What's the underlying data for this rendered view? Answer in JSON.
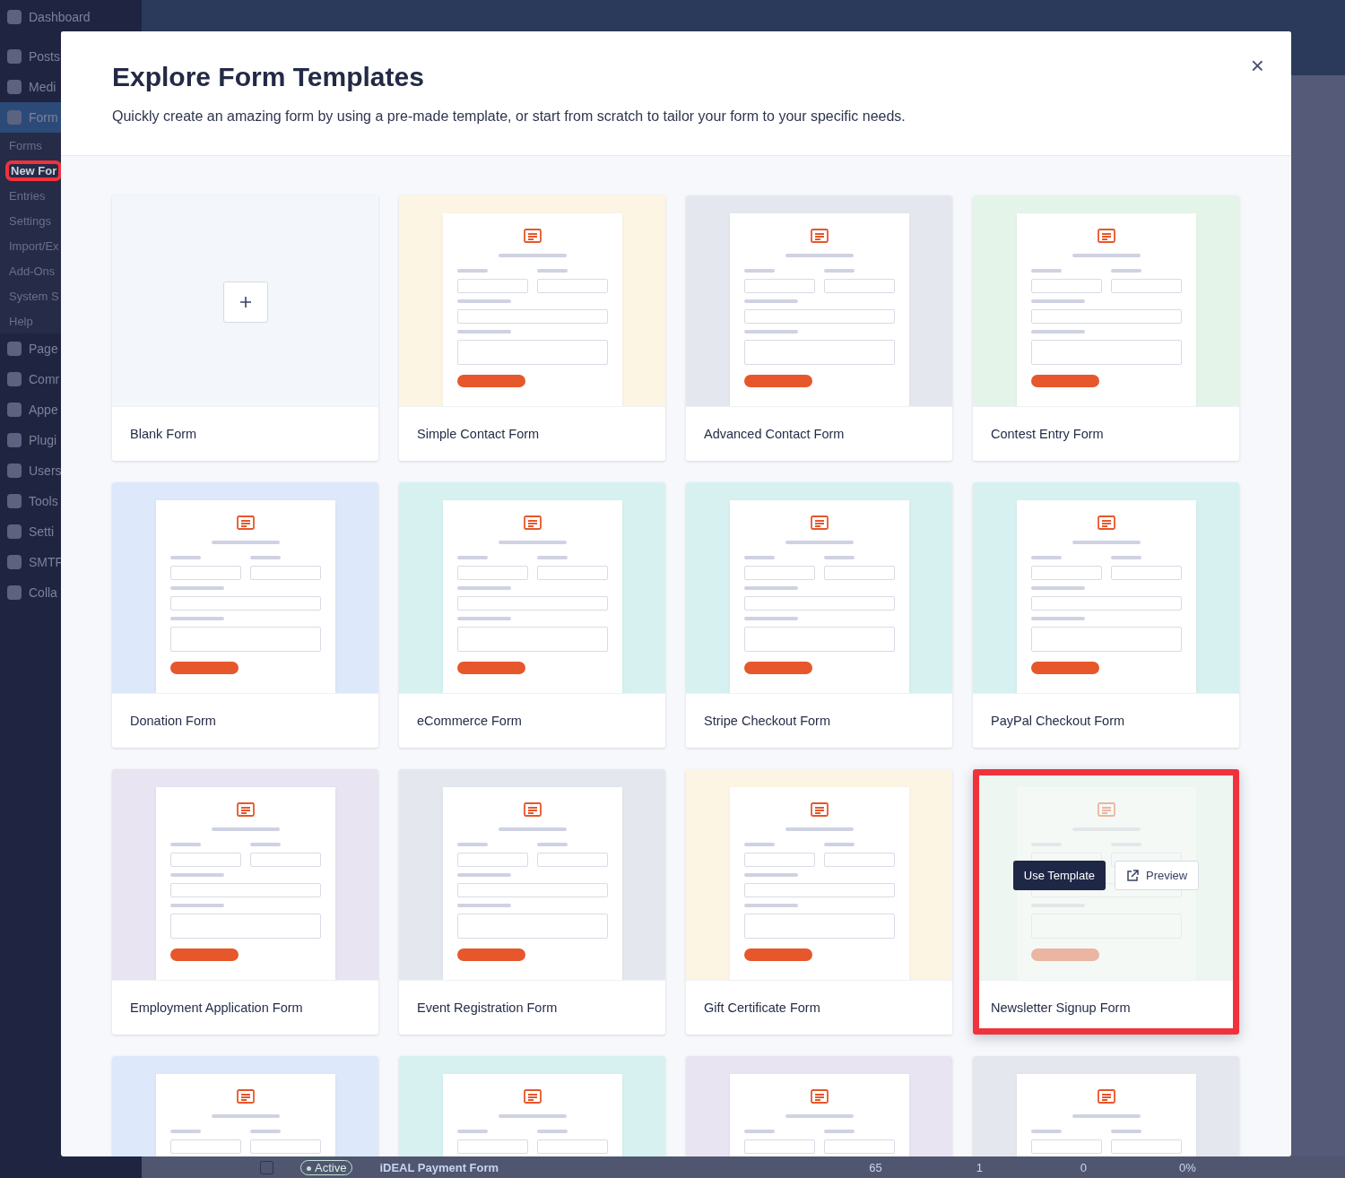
{
  "sidebar": {
    "items": [
      {
        "label": "Dashboard",
        "selected": false,
        "highlighted": false,
        "kind": "main"
      },
      {
        "label": "Posts",
        "selected": false,
        "highlighted": false,
        "kind": "main"
      },
      {
        "label": "Medi",
        "selected": false,
        "highlighted": false,
        "kind": "main"
      },
      {
        "label": "Form",
        "selected": true,
        "highlighted": false,
        "kind": "main"
      },
      {
        "label": "Forms",
        "selected": false,
        "highlighted": false,
        "kind": "sub"
      },
      {
        "label": "New For",
        "selected": true,
        "highlighted": true,
        "kind": "sub"
      },
      {
        "label": "Entries",
        "selected": false,
        "highlighted": false,
        "kind": "sub"
      },
      {
        "label": "Settings",
        "selected": false,
        "highlighted": false,
        "kind": "sub"
      },
      {
        "label": "Import/Ex",
        "selected": false,
        "highlighted": false,
        "kind": "sub"
      },
      {
        "label": "Add-Ons",
        "selected": false,
        "highlighted": false,
        "kind": "sub"
      },
      {
        "label": "System S",
        "selected": false,
        "highlighted": false,
        "kind": "sub"
      },
      {
        "label": "Help",
        "selected": false,
        "highlighted": false,
        "kind": "sub"
      },
      {
        "label": "Page",
        "selected": false,
        "highlighted": false,
        "kind": "main"
      },
      {
        "label": "Comr",
        "selected": false,
        "highlighted": false,
        "kind": "main"
      },
      {
        "label": "Appe",
        "selected": false,
        "highlighted": false,
        "kind": "main"
      },
      {
        "label": "Plugi",
        "selected": false,
        "highlighted": false,
        "kind": "main"
      },
      {
        "label": "Users",
        "selected": false,
        "highlighted": false,
        "kind": "main"
      },
      {
        "label": "Tools",
        "selected": false,
        "highlighted": false,
        "kind": "main"
      },
      {
        "label": "Setti",
        "selected": false,
        "highlighted": false,
        "kind": "main"
      },
      {
        "label": "SMTF",
        "selected": false,
        "highlighted": false,
        "kind": "main"
      },
      {
        "label": "Colla",
        "selected": false,
        "highlighted": false,
        "kind": "main"
      }
    ]
  },
  "background_table_row": {
    "checked": false,
    "status": "Active",
    "name": "iDEAL Payment Form",
    "cells": [
      "65",
      "1",
      "0",
      "0%"
    ]
  },
  "modal": {
    "title": "Explore Form Templates",
    "subtitle": "Quickly create an amazing form by using a pre-made template, or start from scratch to tailor your form to your specific needs.",
    "close": "×",
    "templates": [
      {
        "kind": "blank",
        "title": "Blank Form",
        "color": "#f3f6fa",
        "hovered": false,
        "highlighted": false
      },
      {
        "kind": "template",
        "title": "Simple Contact Form",
        "color": "#fdf5e4",
        "hovered": false,
        "highlighted": false
      },
      {
        "kind": "template",
        "title": "Advanced Contact Form",
        "color": "#e4e8ee",
        "hovered": false,
        "highlighted": false
      },
      {
        "kind": "template",
        "title": "Contest Entry Form",
        "color": "#e5f4e9",
        "hovered": false,
        "highlighted": false
      },
      {
        "kind": "template",
        "title": "Donation Form",
        "color": "#dde8fb",
        "hovered": false,
        "highlighted": false
      },
      {
        "kind": "template",
        "title": "eCommerce Form",
        "color": "#d7f1f1",
        "hovered": false,
        "highlighted": false
      },
      {
        "kind": "template",
        "title": "Stripe Checkout Form",
        "color": "#d7f1f1",
        "hovered": false,
        "highlighted": false
      },
      {
        "kind": "template",
        "title": "PayPal Checkout Form",
        "color": "#d7f1f1",
        "hovered": false,
        "highlighted": false
      },
      {
        "kind": "template",
        "title": "Employment Application Form",
        "color": "#e8e4f2",
        "hovered": false,
        "highlighted": false
      },
      {
        "kind": "template",
        "title": "Event Registration Form",
        "color": "#e4e8ee",
        "hovered": false,
        "highlighted": false
      },
      {
        "kind": "template",
        "title": "Gift Certificate Form",
        "color": "#fdf5e4",
        "hovered": false,
        "highlighted": false
      },
      {
        "kind": "template",
        "title": "Newsletter Signup Form",
        "color": "#eef6f1",
        "hovered": true,
        "highlighted": true,
        "use_label": "Use Template",
        "preview_label": "Preview"
      },
      {
        "kind": "template",
        "color": "#dde8fb",
        "hovered": false,
        "highlighted": false
      },
      {
        "kind": "template",
        "color": "#d7f1f1",
        "hovered": false,
        "highlighted": false
      },
      {
        "kind": "template",
        "color": "#e8e4f2",
        "hovered": false,
        "highlighted": false
      },
      {
        "kind": "template",
        "color": "#e4e8ee",
        "hovered": false,
        "highlighted": false
      }
    ]
  }
}
